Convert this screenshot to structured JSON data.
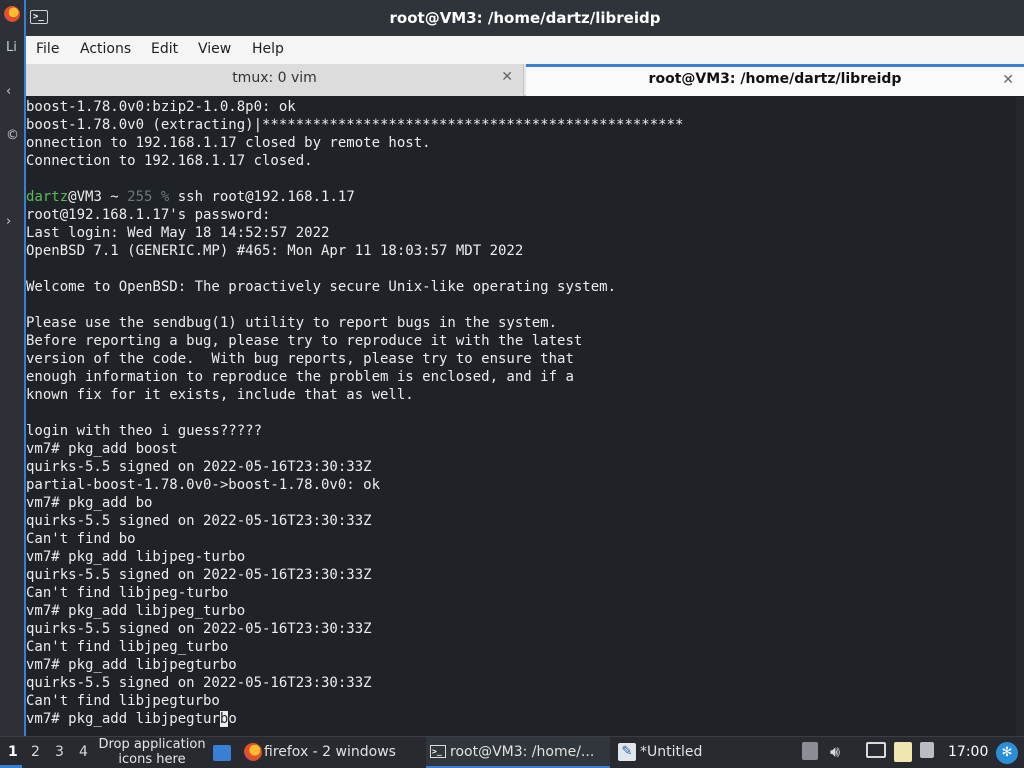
{
  "window": {
    "title": "root@VM3: /home/dartz/libreidp",
    "menu": [
      "File",
      "Actions",
      "Edit",
      "View",
      "Help"
    ],
    "tabs": [
      {
        "label": "tmux: 0 vim",
        "active": false
      },
      {
        "label": "root@VM3: /home/dartz/libreidp",
        "active": true
      }
    ],
    "accent": "#3a7fd6"
  },
  "terminal": {
    "lines_top": [
      "boost-1.78.0v0:bzip2-1.0.8p0: ok",
      "boost-1.78.0v0 (extracting)|**************************************************",
      "onnection to 192.168.1.17 closed by remote host.",
      "Connection to 192.168.1.17 closed.",
      ""
    ],
    "prompt_user": "dartz",
    "prompt_host": "@VM3 ~ ",
    "prompt_status": "255 % ",
    "prompt_command": "ssh root@192.168.1.17",
    "lines_bottom": [
      "root@192.168.1.17's password:",
      "Last login: Wed May 18 14:52:57 2022",
      "OpenBSD 7.1 (GENERIC.MP) #465: Mon Apr 11 18:03:57 MDT 2022",
      "",
      "Welcome to OpenBSD: The proactively secure Unix-like operating system.",
      "",
      "Please use the sendbug(1) utility to report bugs in the system.",
      "Before reporting a bug, please try to reproduce it with the latest",
      "version of the code.  With bug reports, please try to ensure that",
      "enough information to reproduce the problem is enclosed, and if a",
      "known fix for it exists, include that as well.",
      "",
      "login with theo i guess?????",
      "vm7# pkg_add boost",
      "quirks-5.5 signed on 2022-05-16T23:30:33Z",
      "partial-boost-1.78.0v0->boost-1.78.0v0: ok",
      "vm7# pkg_add bo",
      "quirks-5.5 signed on 2022-05-16T23:30:33Z",
      "Can't find bo",
      "vm7# pkg_add libjpeg-turbo",
      "quirks-5.5 signed on 2022-05-16T23:30:33Z",
      "Can't find libjpeg-turbo",
      "vm7# pkg_add libjpeg_turbo",
      "quirks-5.5 signed on 2022-05-16T23:30:33Z",
      "Can't find libjpeg_turbo",
      "vm7# pkg_add libjpegturbo",
      "quirks-5.5 signed on 2022-05-16T23:30:33Z",
      "Can't find libjpegturbo"
    ],
    "current_line_before_cursor": "vm7# pkg_add libjpegtur",
    "cursor_char": "b",
    "current_line_after_cursor": "o"
  },
  "taskbar": {
    "workspaces": [
      "1",
      "2",
      "3",
      "4"
    ],
    "active_workspace": "1",
    "drop_hint": "Drop application icons here",
    "tasks": [
      {
        "label": "firefox - 2 windows",
        "icon": "firefox-icon"
      },
      {
        "label": "root@VM3: /home/...",
        "icon": "terminal-icon"
      },
      {
        "label": "*Untitled",
        "icon": "text-editor-icon"
      }
    ],
    "clock": "17:00"
  },
  "desktop": {
    "left_glyphs": [
      "Li",
      "‹",
      "©",
      "›"
    ]
  }
}
